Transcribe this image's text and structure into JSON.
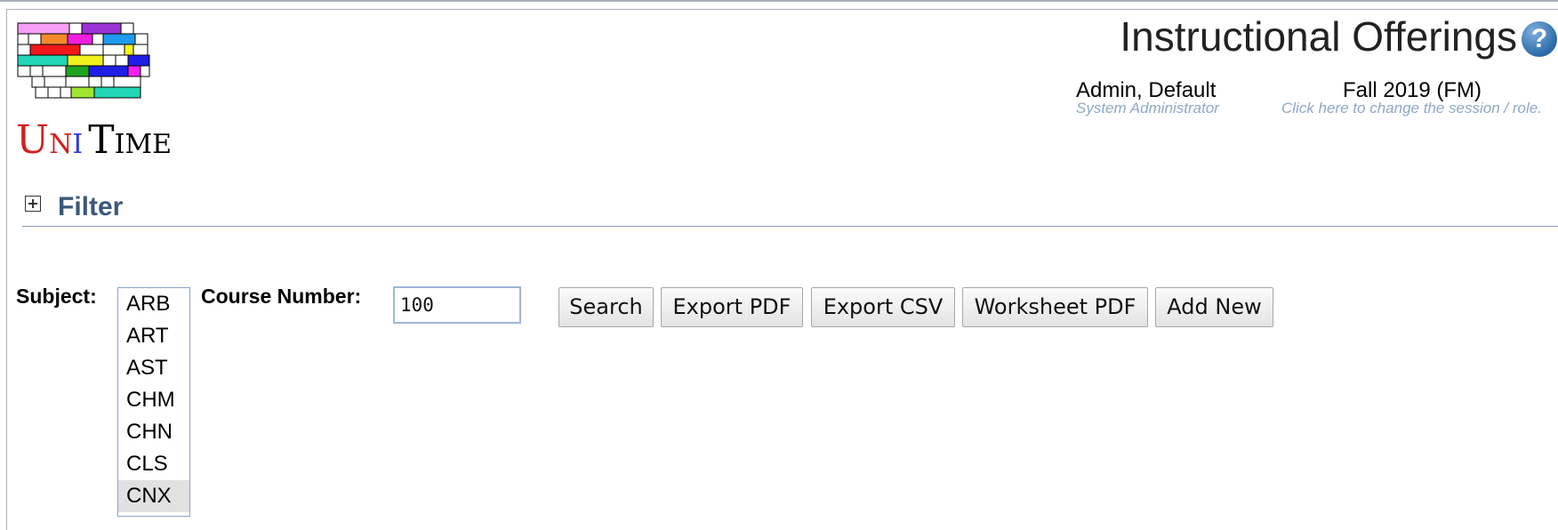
{
  "app": {
    "logo_text": "UniTime",
    "page_title": "Instructional Offerings"
  },
  "user": {
    "name": "Admin, Default",
    "role": "System Administrator"
  },
  "session": {
    "name": "Fall 2019 (FM)",
    "hint": "Click here to change the session / role."
  },
  "filter": {
    "title": "Filter",
    "subject_label": "Subject:",
    "subjects": [
      "ARB",
      "ART",
      "AST",
      "CHM",
      "CHN",
      "CLS",
      "CNX"
    ],
    "selected_subject": "CNX",
    "course_number_label": "Course Number:",
    "course_number_value": "100"
  },
  "buttons": {
    "search": "Search",
    "export_pdf": "Export PDF",
    "export_csv": "Export CSV",
    "worksheet_pdf": "Worksheet PDF",
    "add_new": "Add New"
  },
  "icons": {
    "help": "question-mark-icon",
    "expand": "plus-box-icon"
  }
}
